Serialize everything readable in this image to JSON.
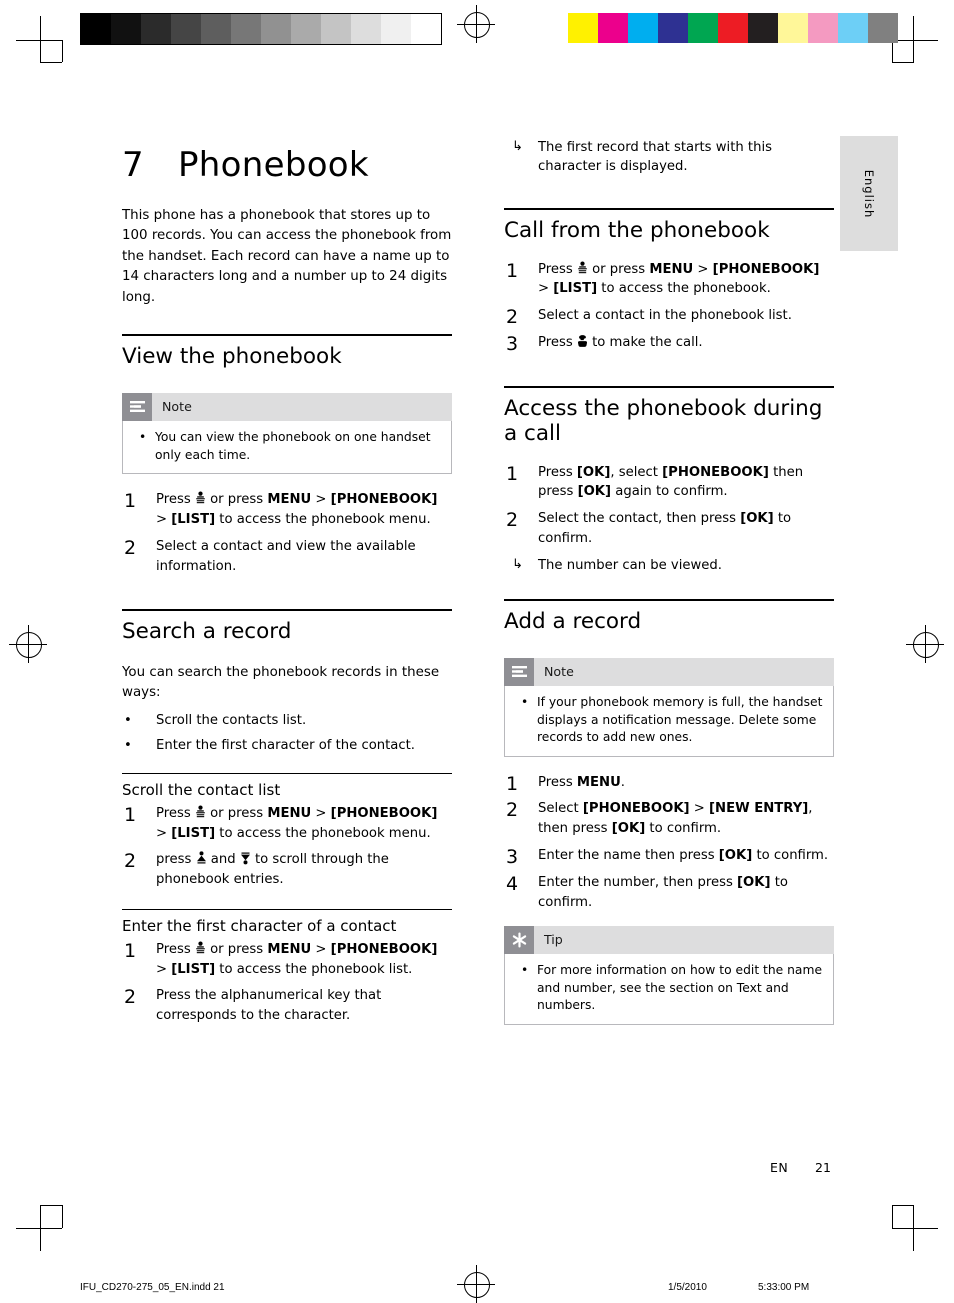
{
  "document": {
    "chapter_number": "7",
    "chapter_title": "Phonebook",
    "side_tab_label": "English",
    "footer": {
      "lang_code": "EN",
      "page_number": "21",
      "file_name": "IFU_CD270-275_05_EN.indd    21",
      "date": "1/5/2010",
      "time": "5:33:00 PM"
    }
  },
  "left_column": {
    "intro": "This phone has a phonebook that stores up to 100 records. You can access the phonebook from the handset. Each record can have a name up to 14 characters long and a number up to 24 digits long.",
    "view_section": {
      "heading": "View the phonebook",
      "note": {
        "title": "Note",
        "items": [
          "You can view the phonebook on one handset only each time."
        ]
      },
      "steps": [
        {
          "n": "1",
          "parts": [
            {
              "t": "Press ",
              "b": false
            },
            {
              "t": "[GLYPH:phonebook]",
              "b": false
            },
            {
              "t": " or press ",
              "b": false
            },
            {
              "t": "MENU",
              "b": true
            },
            {
              "t": " > ",
              "b": false
            },
            {
              "t": "[PHONEBOOK]",
              "b": true
            },
            {
              "t": " > ",
              "b": false
            },
            {
              "t": "[LIST]",
              "b": true
            },
            {
              "t": " to access the phonebook menu.",
              "b": false
            }
          ]
        },
        {
          "n": "2",
          "parts": [
            {
              "t": "Select a contact and view the available information.",
              "b": false
            }
          ]
        }
      ]
    },
    "search_section": {
      "heading": "Search a record",
      "intro": "You can search the phonebook records in these ways:",
      "bullets": [
        "Scroll the contacts list.",
        "Enter the first character of the contact."
      ],
      "sub1": {
        "heading": "Scroll the contact list",
        "steps": [
          {
            "n": "1",
            "parts": [
              {
                "t": "Press ",
                "b": false
              },
              {
                "t": "[GLYPH:phonebook]",
                "b": false
              },
              {
                "t": " or press ",
                "b": false
              },
              {
                "t": "MENU",
                "b": true
              },
              {
                "t": " > ",
                "b": false
              },
              {
                "t": "[PHONEBOOK]",
                "b": true
              },
              {
                "t": " > ",
                "b": false
              },
              {
                "t": "[LIST]",
                "b": true
              },
              {
                "t": " to access the phonebook menu.",
                "b": false
              }
            ]
          },
          {
            "n": "2",
            "parts": [
              {
                "t": "press ",
                "b": false
              },
              {
                "t": "[GLYPH:up]",
                "b": false
              },
              {
                "t": " and ",
                "b": false
              },
              {
                "t": "[GLYPH:down]",
                "b": false
              },
              {
                "t": " to scroll through the phonebook entries.",
                "b": false
              }
            ]
          }
        ]
      },
      "sub2": {
        "heading": "Enter the first character of a contact",
        "steps": [
          {
            "n": "1",
            "parts": [
              {
                "t": "Press ",
                "b": false
              },
              {
                "t": "[GLYPH:phonebook]",
                "b": false
              },
              {
                "t": " or press ",
                "b": false
              },
              {
                "t": "MENU",
                "b": true
              },
              {
                "t": " > ",
                "b": false
              },
              {
                "t": "[PHONEBOOK]",
                "b": true
              },
              {
                "t": " > ",
                "b": false
              },
              {
                "t": "[LIST]",
                "b": true
              },
              {
                "t": " to access the phonebook list.",
                "b": false
              }
            ]
          },
          {
            "n": "2",
            "parts": [
              {
                "t": "Press the alphanumerical key that corresponds to the character.",
                "b": false
              }
            ]
          }
        ]
      }
    }
  },
  "right_column": {
    "top_result": "The first record that starts with this character is displayed.",
    "call_section": {
      "heading": "Call from the phonebook",
      "steps": [
        {
          "n": "1",
          "parts": [
            {
              "t": "Press ",
              "b": false
            },
            {
              "t": "[GLYPH:phonebook]",
              "b": false
            },
            {
              "t": " or press ",
              "b": false
            },
            {
              "t": "MENU",
              "b": true
            },
            {
              "t": " > ",
              "b": false
            },
            {
              "t": "[PHONEBOOK]",
              "b": true
            },
            {
              "t": " > ",
              "b": false
            },
            {
              "t": "[LIST]",
              "b": true
            },
            {
              "t": " to access the phonebook.",
              "b": false
            }
          ]
        },
        {
          "n": "2",
          "parts": [
            {
              "t": "Select a contact in the phonebook list.",
              "b": false
            }
          ]
        },
        {
          "n": "3",
          "parts": [
            {
              "t": "Press ",
              "b": false
            },
            {
              "t": "[GLYPH:call]",
              "b": false
            },
            {
              "t": " to make the call.",
              "b": false
            }
          ]
        }
      ]
    },
    "access_section": {
      "heading": "Access the phonebook during a call",
      "steps": [
        {
          "n": "1",
          "parts": [
            {
              "t": "Press ",
              "b": false
            },
            {
              "t": "[OK]",
              "b": true
            },
            {
              "t": ", select ",
              "b": false
            },
            {
              "t": "[PHONEBOOK]",
              "b": true
            },
            {
              "t": " then press ",
              "b": false
            },
            {
              "t": "[OK]",
              "b": true
            },
            {
              "t": " again to confirm.",
              "b": false
            }
          ]
        },
        {
          "n": "2",
          "parts": [
            {
              "t": "Select the contact, then press ",
              "b": false
            },
            {
              "t": "[OK]",
              "b": true
            },
            {
              "t": " to confirm.",
              "b": false
            }
          ],
          "result": "The number can be viewed."
        }
      ]
    },
    "add_section": {
      "heading": "Add a record",
      "note": {
        "title": "Note",
        "items": [
          "If your phonebook memory is full, the handset displays a notification message. Delete some records to add new ones."
        ]
      },
      "steps": [
        {
          "n": "1",
          "parts": [
            {
              "t": "Press ",
              "b": false
            },
            {
              "t": "MENU",
              "b": true
            },
            {
              "t": ".",
              "b": false
            }
          ]
        },
        {
          "n": "2",
          "parts": [
            {
              "t": "Select ",
              "b": false
            },
            {
              "t": "[PHONEBOOK]",
              "b": true
            },
            {
              "t": " > ",
              "b": false
            },
            {
              "t": "[NEW ENTRY]",
              "b": true
            },
            {
              "t": ", then press ",
              "b": false
            },
            {
              "t": "[OK]",
              "b": true
            },
            {
              "t": " to confirm.",
              "b": false
            }
          ]
        },
        {
          "n": "3",
          "parts": [
            {
              "t": "Enter the name then press ",
              "b": false
            },
            {
              "t": "[OK]",
              "b": true
            },
            {
              "t": " to confirm.",
              "b": false
            }
          ]
        },
        {
          "n": "4",
          "parts": [
            {
              "t": "Enter the number, then press ",
              "b": false
            },
            {
              "t": "[OK]",
              "b": true
            },
            {
              "t": " to confirm.",
              "b": false
            }
          ]
        }
      ],
      "tip": {
        "title": "Tip",
        "items": [
          "For more information on how to edit the name and number, see the section on Text and numbers."
        ]
      }
    }
  },
  "print_marks": {
    "grayscale_swatches": [
      "#000000",
      "#111111",
      "#2b2b2b",
      "#454545",
      "#5e5e5e",
      "#777777",
      "#919191",
      "#aaaaaa",
      "#c4c4c4",
      "#dddddd",
      "#f0f0f0",
      "#ffffff"
    ],
    "color_swatches": [
      "#fff100",
      "#ec008c",
      "#00aeef",
      "#2e3192",
      "#00a651",
      "#ed1c24",
      "#231f20",
      "#fff799",
      "#f49ac1",
      "#6dcff6",
      "#808080"
    ]
  }
}
